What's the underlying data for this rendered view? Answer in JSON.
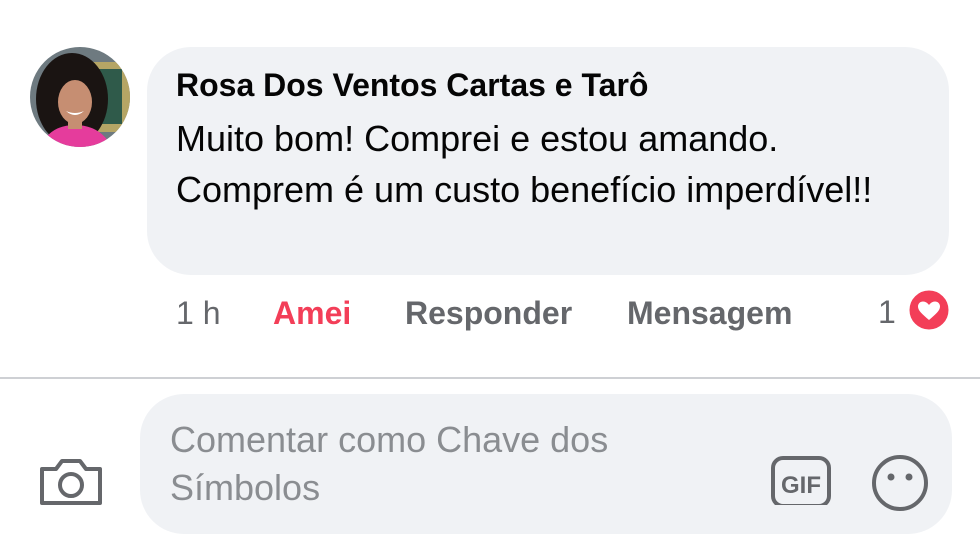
{
  "comment": {
    "author": "Rosa Dos Ventos Cartas e Tarô",
    "text": "Muito bom! Comprei e estou amando. Comprem é um custo benefício imperdível!!",
    "timestamp": "1 h",
    "reaction_label": "Amei",
    "reply_label": "Responder",
    "message_label": "Mensagem",
    "reaction_count": "1",
    "reaction_icon": "heart-icon"
  },
  "composer": {
    "placeholder": "Comentar como Chave dos Símbolos",
    "camera_icon": "camera-icon",
    "gif_icon": "gif-icon",
    "emoji_icon": "emoji-icon"
  },
  "colors": {
    "bubble_bg": "#f0f2f5",
    "reaction_red": "#f33e58",
    "muted_text": "#65676b"
  }
}
